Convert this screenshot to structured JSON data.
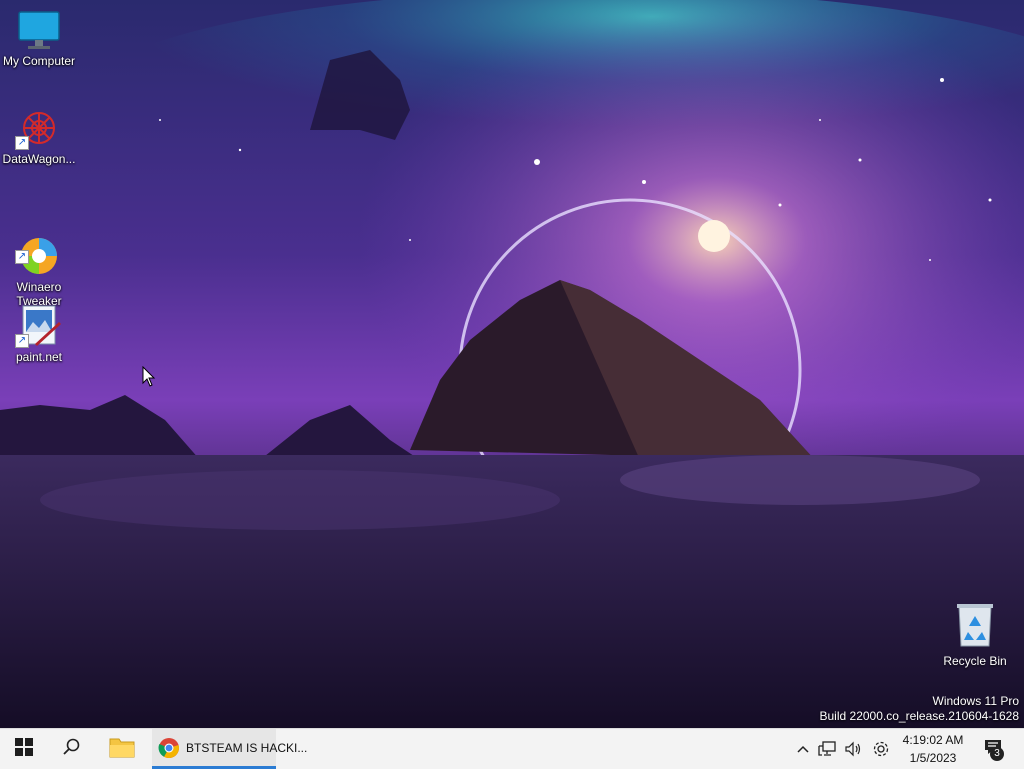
{
  "desktop": {
    "icons": [
      {
        "label": "My Computer",
        "icon": "monitor-icon"
      },
      {
        "label": "DataWagon...",
        "icon": "datawagon-icon"
      },
      {
        "label": "Winaero\nTweaker",
        "icon": "winaero-tweaker-icon"
      },
      {
        "label": "paint.net",
        "icon": "paint-net-icon"
      }
    ],
    "recycle_bin": {
      "label": "Recycle Bin",
      "icon": "recycle-bin-icon"
    },
    "watermark": {
      "line1": "Windows 11 Pro",
      "line2": "Build 22000.co_release.210604-1628"
    }
  },
  "taskbar": {
    "start_icon": "windows-start-icon",
    "search_icon": "search-icon",
    "explorer_icon": "file-explorer-icon",
    "active_app": {
      "label": "BTSTEAM IS HACKI...",
      "icon": "chrome-icon"
    },
    "tray": {
      "chevron_icon": "chevron-up-icon",
      "network_icon": "network-icon",
      "volume_icon": "volume-icon",
      "settings_icon": "gear-icon"
    },
    "clock": {
      "time": "4:19:02 AM",
      "date": "1/5/2023"
    },
    "notifications": {
      "count": "3",
      "icon": "notification-icon"
    },
    "accent_color": "#2b7cd3"
  }
}
